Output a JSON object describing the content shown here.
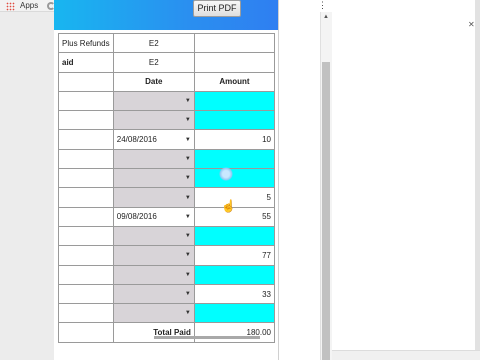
{
  "bookmarks": {
    "apps_label": "Apps"
  },
  "toolbar": {
    "print_label": "Print PDF"
  },
  "summary": [
    {
      "label": "Plus Refunds",
      "code": "E2"
    },
    {
      "label": "aid",
      "code": "E2"
    }
  ],
  "table": {
    "headers": {
      "date": "Date",
      "amount": "Amount"
    },
    "rows": [
      {
        "date": "",
        "amount": ""
      },
      {
        "date": "",
        "amount": ""
      },
      {
        "date": "24/08/2016",
        "amount": "10"
      },
      {
        "date": "",
        "amount": ""
      },
      {
        "date": "",
        "amount": ""
      },
      {
        "date": "",
        "amount": "5"
      },
      {
        "date": "09/08/2016",
        "amount": "55"
      },
      {
        "date": "",
        "amount": ""
      },
      {
        "date": "",
        "amount": "77"
      },
      {
        "date": "",
        "amount": ""
      },
      {
        "date": "",
        "amount": "33"
      },
      {
        "date": "",
        "amount": ""
      }
    ],
    "total_label": "Total Paid",
    "total_value": "180.00"
  },
  "colors": {
    "header_gradient_start": "#18b6f0",
    "header_gradient_end": "#2f7ff1",
    "empty_amount": "#00ffff",
    "date_select": "#d8d4d8"
  },
  "icons": {
    "apps": "apps-grid-icon",
    "menu": "chrome-menu-icon",
    "cursor": "hand-cursor-icon"
  }
}
